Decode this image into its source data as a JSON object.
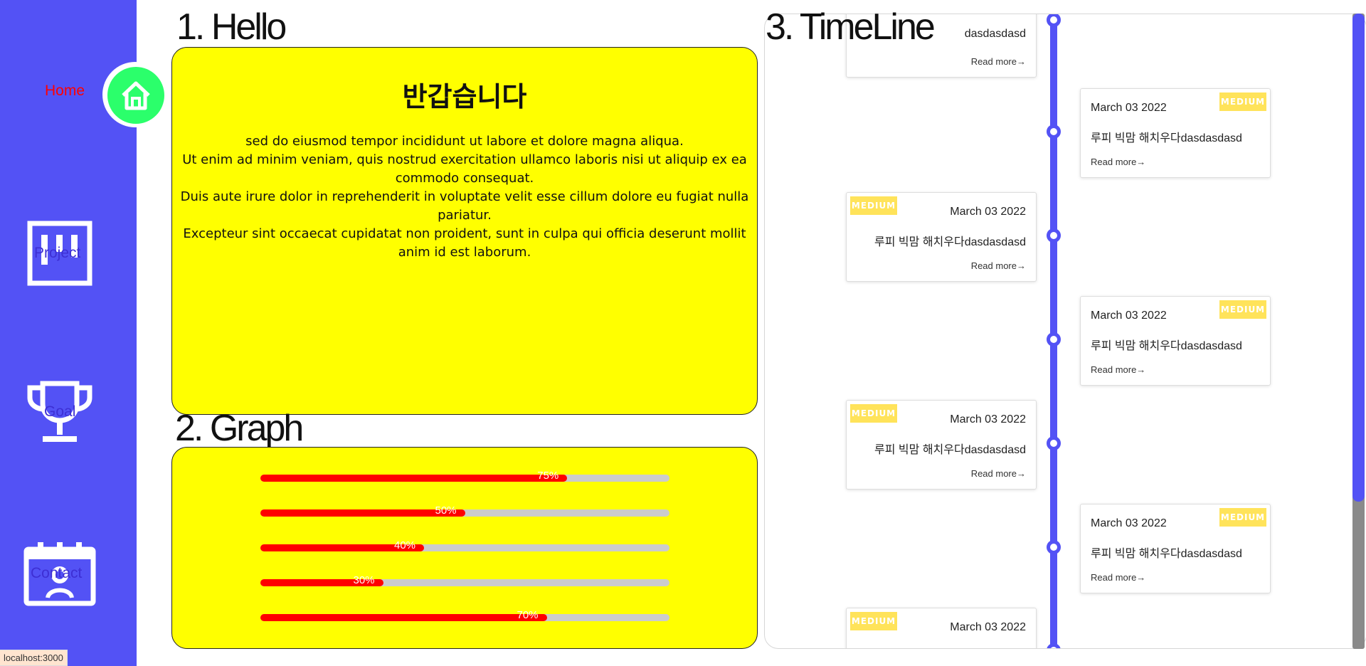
{
  "sidebar": {
    "items": [
      {
        "label": "Home",
        "icon": "home-icon"
      },
      {
        "label": "Project",
        "icon": "kanban-board-icon"
      },
      {
        "label": "Goal",
        "icon": "trophy-icon"
      },
      {
        "label": "Contact",
        "icon": "calendar-contact-icon"
      }
    ],
    "active": "Home"
  },
  "hello": {
    "title": "1. Hello",
    "heading": "반갑습니다",
    "body_lines": [
      "sed do eiusmod tempor incididunt ut labore et dolore magna aliqua.",
      "Ut enim ad minim veniam, quis nostrud exercitation ullamco laboris nisi ut aliquip ex ea commodo consequat.",
      "Duis aute irure dolor in reprehenderit in voluptate velit esse cillum dolore eu fugiat nulla pariatur.",
      "Excepteur sint occaecat cupidatat non proident, sunt in culpa qui officia deserunt mollit anim id est laborum."
    ]
  },
  "graph": {
    "title": "2. Graph",
    "bars": [
      {
        "label": "75%",
        "value": 0.75
      },
      {
        "label": "50%",
        "value": 0.5
      },
      {
        "label": "40%",
        "value": 0.4
      },
      {
        "label": "30%",
        "value": 0.3
      },
      {
        "label": "70%",
        "value": 0.7
      }
    ]
  },
  "timeline": {
    "title": "3. TimeLine",
    "items": [
      {
        "side": "left",
        "badge": "",
        "date": "",
        "text": "dasdasdasd",
        "read_more": "Read more→"
      },
      {
        "side": "right",
        "badge": "MEDIUM",
        "date": "March 03 2022",
        "text": "루피 빅맘 해치우다dasdasdasd",
        "read_more": "Read more→"
      },
      {
        "side": "left",
        "badge": "MEDIUM",
        "date": "March 03 2022",
        "text": "루피 빅맘 해치우다dasdasdasd",
        "read_more": "Read more→"
      },
      {
        "side": "right",
        "badge": "MEDIUM",
        "date": "March 03 2022",
        "text": "루피 빅맘 해치우다dasdasdasd",
        "read_more": "Read more→"
      },
      {
        "side": "left",
        "badge": "MEDIUM",
        "date": "March 03 2022",
        "text": "루피 빅맘 해치우다dasdasdasd",
        "read_more": "Read more→"
      },
      {
        "side": "right",
        "badge": "MEDIUM",
        "date": "March 03 2022",
        "text": "루피 빅맘 해치우다dasdasdasd",
        "read_more": "Read more→"
      },
      {
        "side": "left",
        "badge": "MEDIUM",
        "date": "March 03 2022",
        "text": "",
        "read_more": ""
      }
    ]
  },
  "status_bar": {
    "url": "localhost:3000"
  },
  "colors": {
    "sidebar": "#5352f5",
    "card_yellow": "#ffff00",
    "bar_fill": "#ff0000",
    "bar_track": "#cccccc",
    "home_active": "#2bff6b",
    "badge": "#ffe35a",
    "timeline_line": "#5352f5"
  }
}
